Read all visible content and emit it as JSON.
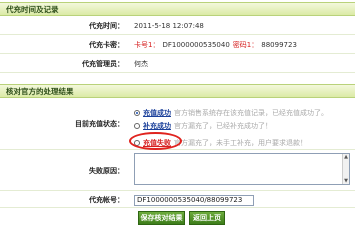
{
  "section1": {
    "title": "代充时间及记录",
    "time_label": "代充时间：",
    "time_value": "2011-5-18 12:07:48",
    "card_label": "代充卡密：",
    "card_number_prefix": "卡号1：",
    "card_number": "DF1000000535040",
    "card_password_prefix": "密码1：",
    "card_password": "88099723",
    "admin_label": "代充管理员：",
    "admin_value": "何杰"
  },
  "section2": {
    "title": "核对官方的处理结果",
    "status_label": "目前充值状态：",
    "options": [
      {
        "label": "充值成功",
        "hint": "官方销售系统存在该充值记录，已经充值成功了。",
        "selected": true
      },
      {
        "label": "补充成功",
        "hint": "官方漏充了，已经补充成功了！",
        "selected": false
      },
      {
        "label": "充值失败",
        "hint": "官方漏充了，未手工补充，用户要求退款！",
        "selected": false
      }
    ],
    "reason_label": "失败原因：",
    "reason_value": "",
    "account_label": "代充帐号：",
    "account_value": "DF1000000535040/88099723",
    "save_button": "保存核对结果",
    "back_button": "返回上页"
  },
  "colors": {
    "header_bg": "#dbeaa6",
    "button_bg": "#3d7d1a",
    "link_blue": "#1a3f9a",
    "alert_red": "#d61e1e"
  }
}
